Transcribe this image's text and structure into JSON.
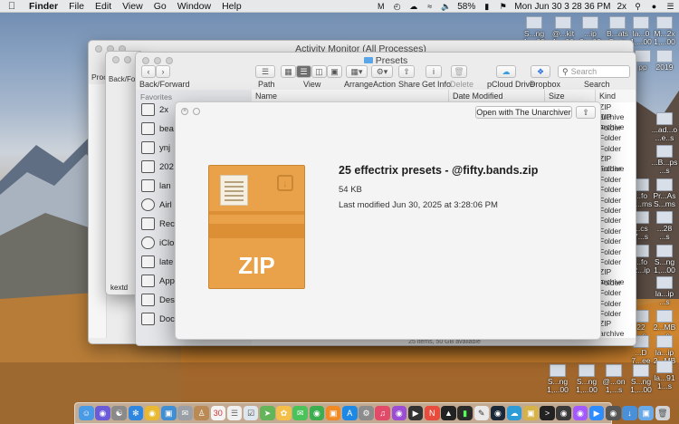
{
  "menubar": {
    "app_name": "Finder",
    "menus": [
      "File",
      "Edit",
      "View",
      "Go",
      "Window",
      "Help"
    ],
    "battery": "58%",
    "clock": "Mon Jun 30  3 28 36 PM",
    "zoom": "2x"
  },
  "desktop_icons": [
    {
      "label": "S...ng\n1,...00"
    },
    {
      "label": "@...kit\n1,...00"
    },
    {
      "label": "...ip\n2,...00"
    },
    {
      "label": "B...ats\nS...ip"
    },
    {
      "label": "la...0\n1,...00"
    },
    {
      "label": "M...2x\n1,...00"
    },
    {
      "label": "pp"
    },
    {
      "label": "2019"
    },
    {
      "label": "...ad...o\n...e..s"
    },
    {
      "label": "...B...ps\n...s"
    },
    {
      "label": "...fo\nN...ms"
    },
    {
      "label": "Pr...As\nS...ms"
    },
    {
      "label": "...cs\n7...s"
    },
    {
      "label": "...28\n...s"
    },
    {
      "label": "...fo\nR...ip"
    },
    {
      "label": "S...ng\n1,...00"
    },
    {
      "label": "la...ip\n...s"
    },
    {
      "label": "2...MB\n...s"
    },
    {
      "label": "22\n...s"
    },
    {
      "label": "la...ip\n2...MB"
    },
    {
      "label": "...D\n7...ee"
    },
    {
      "label": "la...91\n1...s"
    },
    {
      "label": "S...ng\n1,...00"
    },
    {
      "label": "S...ng\n1,...00"
    },
    {
      "label": "@...on\n1,...s"
    },
    {
      "label": "S...ng\n1,...00"
    },
    {
      "label": "la...ip\n1,...s"
    }
  ],
  "activity_monitor": {
    "title": "Activity Monitor (All Processes)",
    "proc_label": "Proce",
    "footer_label": "kextd"
  },
  "finder": {
    "title": "Presets",
    "toolbar": {
      "back_forward": "Back/Forward",
      "path": "Path",
      "view": "View",
      "arrange": "Arrange",
      "action": "Action",
      "share": "Share",
      "get_info": "Get Info",
      "delete": "Delete",
      "pcloud": "pCloud Drive",
      "dropbox": "Dropbox",
      "search_label": "Search",
      "search_placeholder": "Search"
    },
    "sidebar_header": "Favorites",
    "sidebar_items": [
      "2x",
      "bea",
      "ynj",
      "202",
      "lan",
      "Airl",
      "Rec",
      "iClo",
      "late",
      "App",
      "Des",
      "Doc"
    ],
    "columns": {
      "name": "Name",
      "date": "Date Modified",
      "size": "Size",
      "kind": "Kind"
    },
    "kinds": [
      "ZIP archive",
      "ZIP archive",
      "Folder",
      "Folder",
      "Folder",
      "ZIP archive",
      "Folder",
      "Folder",
      "Folder",
      "Folder",
      "Folder",
      "Folder",
      "Folder",
      "Folder",
      "Folder",
      "Folder",
      "ZIP archive",
      "Folder",
      "Folder",
      "Folder",
      "Folder",
      "ZIP archive"
    ],
    "status": "25 items, 50 GB available"
  },
  "quicklook": {
    "open_button": "Open with The Unarchiver",
    "filename": "25 effectrix presets - @fifty.bands.zip",
    "size": "54 KB",
    "modified": "Last modified Jun 30, 2025 at 3:28:06 PM",
    "icon_text": "ZIP"
  },
  "colors": {
    "zip_orange": "#e9a24a",
    "menubar": "#ececec"
  }
}
